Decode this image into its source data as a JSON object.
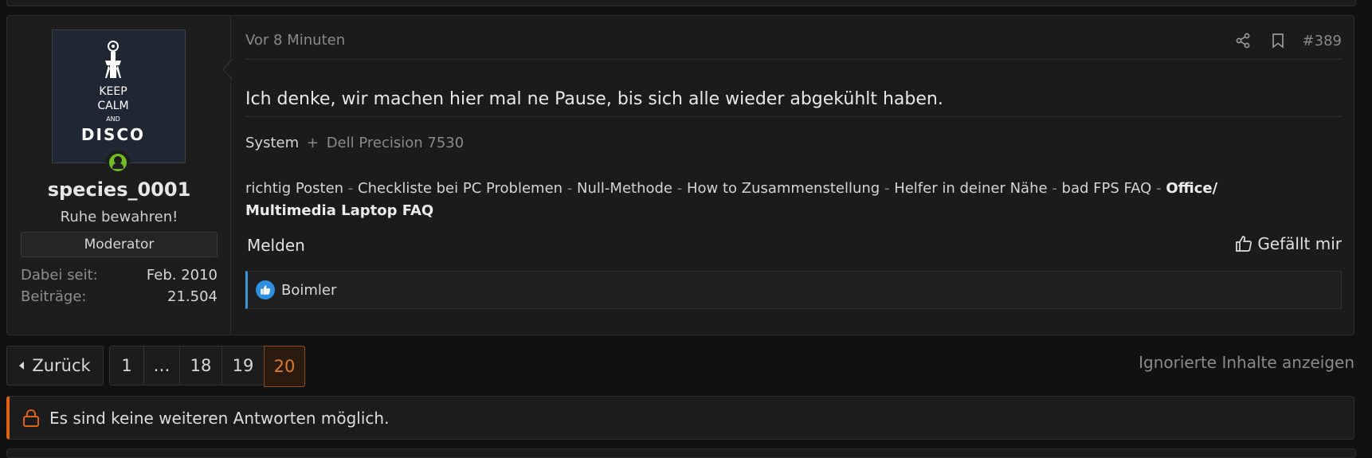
{
  "post": {
    "author": {
      "username": "species_0001",
      "user_title": "Ruhe bewahren!",
      "role": "Moderator",
      "avatar_text": [
        "KEEP",
        "CALM",
        "AND",
        "DISCO"
      ],
      "stats": [
        {
          "label": "Dabei seit:",
          "value": "Feb. 2010"
        },
        {
          "label": "Beiträge:",
          "value": "21.504"
        }
      ],
      "online_status_icon": "online-user-icon",
      "online_color": "#6fbd20"
    },
    "time": "Vor 8 Minuten",
    "number": "#389",
    "message": "Ich denke, wir machen hier mal ne Pause, bis sich alle wieder abgekühlt haben.",
    "signature": {
      "system_label": "System",
      "system_plus": "+",
      "system_value": "Dell Precision 7530",
      "links": [
        "richtig Posten",
        "Checkliste bei PC Problemen",
        "Null-Methode",
        "How to Zusammenstellung",
        "Helfer in deiner Nähe",
        "bad FPS FAQ"
      ],
      "separator": "-",
      "bold_link_line1": "Office/",
      "bold_link_line2": "Multimedia Laptop FAQ"
    },
    "actions": {
      "report": "Melden",
      "like": "Gefällt mir"
    },
    "reactions": {
      "names": "Boimler",
      "icon": "thumbs-up-icon",
      "color": "#2d8fe0"
    }
  },
  "pagination": {
    "prev": "Zurück",
    "pages": [
      "1",
      "…",
      "18",
      "19",
      "20"
    ],
    "current": "20",
    "ignored_link": "Ignorierte Inhalte anzeigen"
  },
  "notice": {
    "text": "Es sind keine weiteren Antworten möglich.",
    "icon": "lock-icon",
    "accent": "#e0620f"
  }
}
